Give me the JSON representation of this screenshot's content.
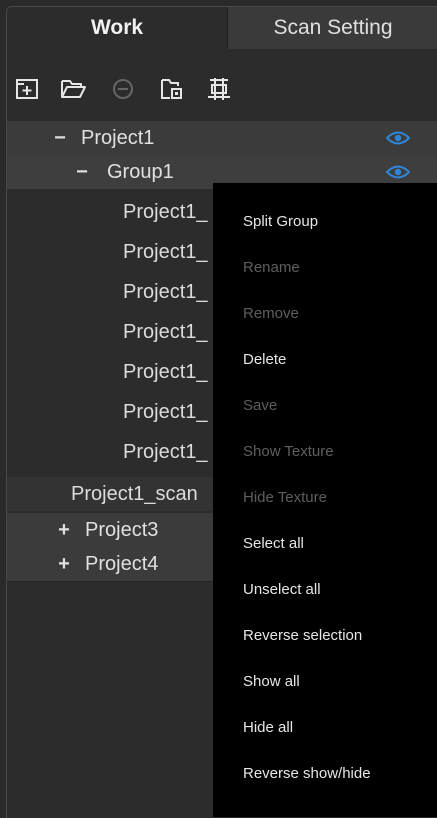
{
  "tabs": {
    "work": "Work",
    "scan_setting": "Scan Setting"
  },
  "toolbar": [
    "add-project-icon",
    "open-folder-icon",
    "remove-icon",
    "export-icon",
    "merge-icon"
  ],
  "tree": {
    "project1": "Project1",
    "group1": "Group1",
    "group_items": [
      "Project1_",
      "Project1_",
      "Project1_",
      "Project1_",
      "Project1_",
      "Project1_",
      "Project1_"
    ],
    "scan_item": "Project1_scan",
    "project3": "Project3",
    "project4": "Project4",
    "expanded_sign": "−",
    "collapsed_sign": "+"
  },
  "context_menu": {
    "items": [
      {
        "label": "Split Group",
        "enabled": true
      },
      {
        "label": "Rename",
        "enabled": false
      },
      {
        "label": "Remove",
        "enabled": false
      },
      {
        "label": "Delete",
        "enabled": true
      },
      {
        "label": "Save",
        "enabled": false
      },
      {
        "label": "Show Texture",
        "enabled": false
      },
      {
        "label": "Hide Texture",
        "enabled": false
      },
      {
        "label": "Select all",
        "enabled": true
      },
      {
        "label": "Unselect all",
        "enabled": true
      },
      {
        "label": "Reverse selection",
        "enabled": true
      },
      {
        "label": "Show all",
        "enabled": true
      },
      {
        "label": "Hide all",
        "enabled": true
      },
      {
        "label": "Reverse show/hide",
        "enabled": true
      }
    ]
  },
  "colors": {
    "eye_icon": "#2f86d8",
    "menu_bg": "#000000",
    "disabled_text": "#5e5e5e"
  }
}
